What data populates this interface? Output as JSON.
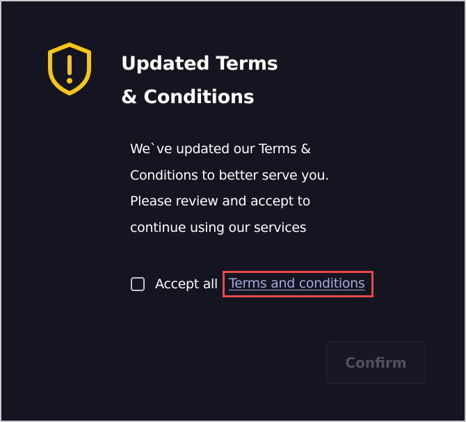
{
  "dialog": {
    "icon": "shield-exclamation-icon",
    "title_line1": "Updated Terms",
    "title_line2": "& Conditions",
    "body_line1": "We`ve updated our Terms &",
    "body_line2": "Conditions to better serve you.",
    "body_line3": "Please review and accept to",
    "body_line4": "continue using our services",
    "accept_label": "Accept all",
    "terms_link_text": "Terms and conditions",
    "checkbox_checked": false,
    "confirm_label": "Confirm",
    "confirm_enabled": false
  },
  "colors": {
    "background": "#151521",
    "icon_accent": "#f5c518",
    "link": "#a8a8e0",
    "highlight_box": "#e5484d",
    "disabled_text": "#50505f"
  }
}
